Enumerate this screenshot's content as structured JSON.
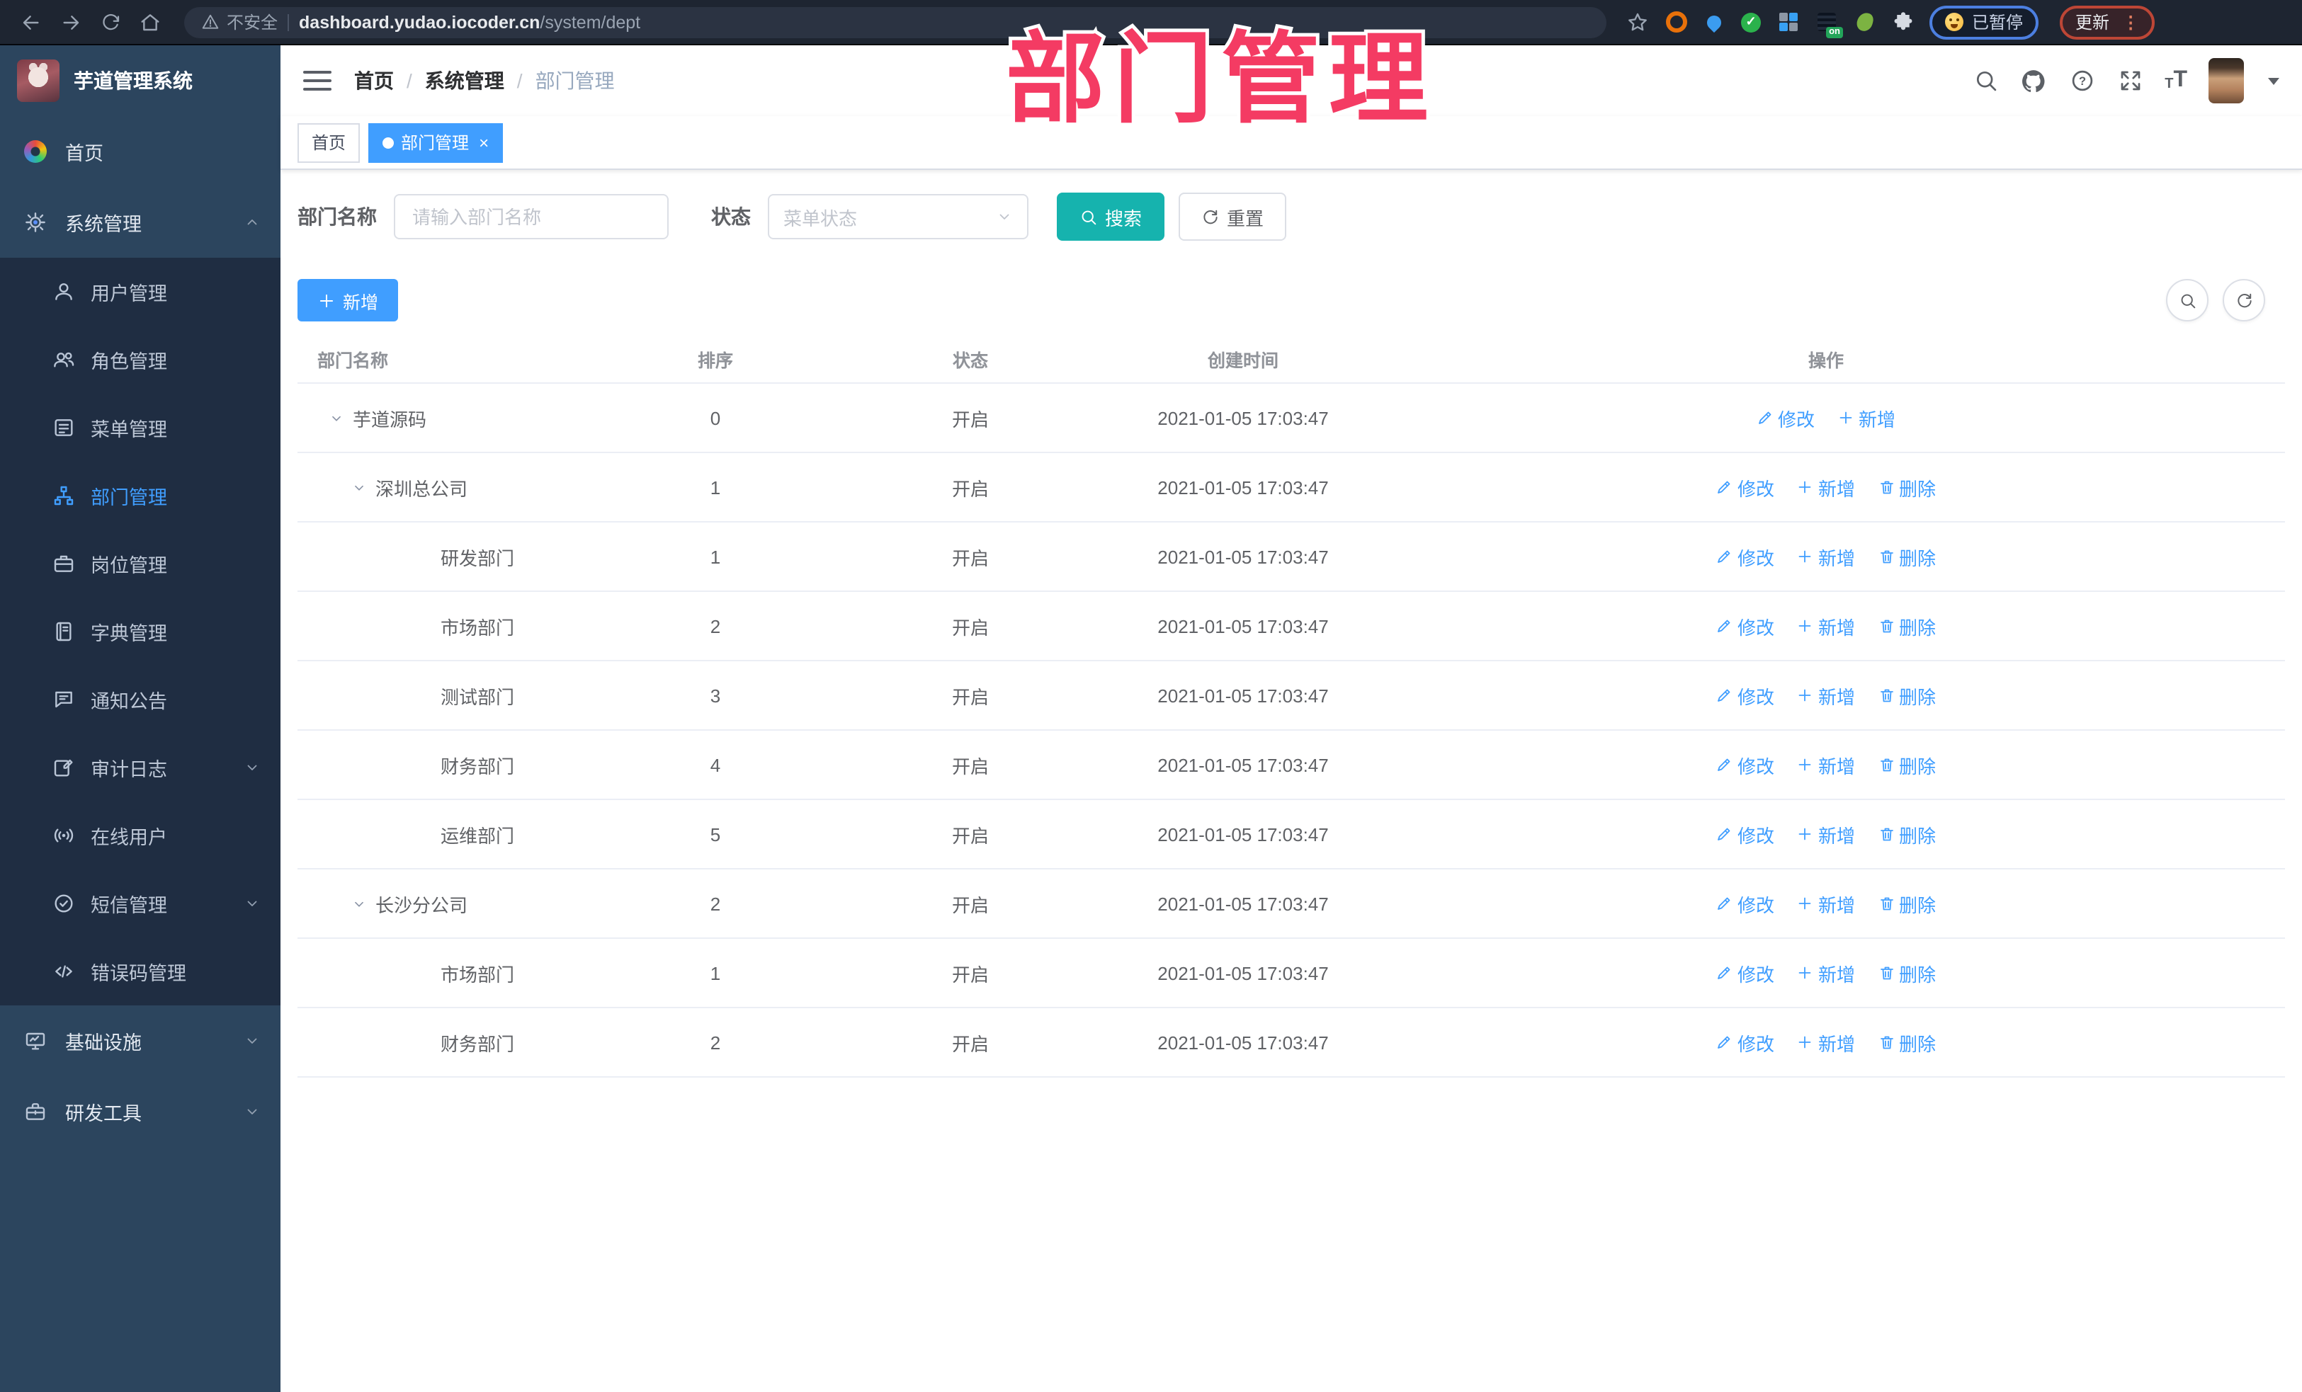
{
  "browser": {
    "security_label": "不安全",
    "url_host": "dashboard.yudao.iocoder.cn",
    "url_path": "/system/dept",
    "ext_on_badge": "on",
    "profile_status": "已暂停",
    "update_label": "更新"
  },
  "annotation": {
    "text": "部门管理",
    "color": "#f43b63"
  },
  "app": {
    "title": "芋道管理系统",
    "breadcrumb": [
      "首页",
      "系统管理",
      "部门管理"
    ],
    "tabs": [
      {
        "label": "首页",
        "active": false
      },
      {
        "label": "部门管理",
        "active": true
      }
    ]
  },
  "sidebar": {
    "items": [
      {
        "label": "首页",
        "icon": "dashboard-icon",
        "level": 1
      },
      {
        "label": "系统管理",
        "icon": "gear-icon",
        "level": 1,
        "arrow": "up"
      },
      {
        "label": "用户管理",
        "icon": "user-icon",
        "level": 2
      },
      {
        "label": "角色管理",
        "icon": "users-icon",
        "level": 2
      },
      {
        "label": "菜单管理",
        "icon": "menu-icon",
        "level": 2
      },
      {
        "label": "部门管理",
        "icon": "tree-icon",
        "level": 2,
        "active": true
      },
      {
        "label": "岗位管理",
        "icon": "briefcase-icon",
        "level": 2
      },
      {
        "label": "字典管理",
        "icon": "book-icon",
        "level": 2
      },
      {
        "label": "通知公告",
        "icon": "megaphone-icon",
        "level": 2
      },
      {
        "label": "审计日志",
        "icon": "log-icon",
        "level": 2,
        "arrow": "down"
      },
      {
        "label": "在线用户",
        "icon": "online-icon",
        "level": 2
      },
      {
        "label": "短信管理",
        "icon": "sms-icon",
        "level": 2,
        "arrow": "down"
      },
      {
        "label": "错误码管理",
        "icon": "code-icon",
        "level": 2
      },
      {
        "label": "基础设施",
        "icon": "monitor-icon",
        "level": 1,
        "arrow": "down"
      },
      {
        "label": "研发工具",
        "icon": "tools-icon",
        "level": 1,
        "arrow": "down"
      }
    ]
  },
  "toolbar": {
    "search_form": {
      "name_label": "部门名称",
      "name_placeholder": "请输入部门名称",
      "status_label": "状态",
      "status_placeholder": "菜单状态",
      "search_label": "搜索",
      "reset_label": "重置"
    },
    "add_label": "新增"
  },
  "table": {
    "columns": [
      "部门名称",
      "排序",
      "状态",
      "创建时间",
      "操作"
    ],
    "action_labels": {
      "edit": "修改",
      "add": "新增",
      "delete": "删除"
    },
    "rows": [
      {
        "name": "芋道源码",
        "sort": "0",
        "status": "开启",
        "created": "2021-01-05 17:03:47",
        "level": 0,
        "expandable": true,
        "actions": [
          "edit",
          "add"
        ]
      },
      {
        "name": "深圳总公司",
        "sort": "1",
        "status": "开启",
        "created": "2021-01-05 17:03:47",
        "level": 1,
        "expandable": true,
        "actions": [
          "edit",
          "add",
          "delete"
        ]
      },
      {
        "name": "研发部门",
        "sort": "1",
        "status": "开启",
        "created": "2021-01-05 17:03:47",
        "level": 2,
        "expandable": false,
        "actions": [
          "edit",
          "add",
          "delete"
        ]
      },
      {
        "name": "市场部门",
        "sort": "2",
        "status": "开启",
        "created": "2021-01-05 17:03:47",
        "level": 2,
        "expandable": false,
        "actions": [
          "edit",
          "add",
          "delete"
        ]
      },
      {
        "name": "测试部门",
        "sort": "3",
        "status": "开启",
        "created": "2021-01-05 17:03:47",
        "level": 2,
        "expandable": false,
        "actions": [
          "edit",
          "add",
          "delete"
        ]
      },
      {
        "name": "财务部门",
        "sort": "4",
        "status": "开启",
        "created": "2021-01-05 17:03:47",
        "level": 2,
        "expandable": false,
        "actions": [
          "edit",
          "add",
          "delete"
        ]
      },
      {
        "name": "运维部门",
        "sort": "5",
        "status": "开启",
        "created": "2021-01-05 17:03:47",
        "level": 2,
        "expandable": false,
        "actions": [
          "edit",
          "add",
          "delete"
        ]
      },
      {
        "name": "长沙分公司",
        "sort": "2",
        "status": "开启",
        "created": "2021-01-05 17:03:47",
        "level": 1,
        "expandable": true,
        "actions": [
          "edit",
          "add",
          "delete"
        ]
      },
      {
        "name": "市场部门",
        "sort": "1",
        "status": "开启",
        "created": "2021-01-05 17:03:47",
        "level": 2,
        "expandable": false,
        "actions": [
          "edit",
          "add",
          "delete"
        ]
      },
      {
        "name": "财务部门",
        "sort": "2",
        "status": "开启",
        "created": "2021-01-05 17:03:47",
        "level": 2,
        "expandable": false,
        "actions": [
          "edit",
          "add",
          "delete"
        ]
      }
    ]
  },
  "colors": {
    "primary": "#409eff",
    "search_button": "#16b3ae",
    "sidebar_bg": "#2c455e",
    "submenu_bg": "#1f2d42",
    "annotation": "#f43b63"
  }
}
